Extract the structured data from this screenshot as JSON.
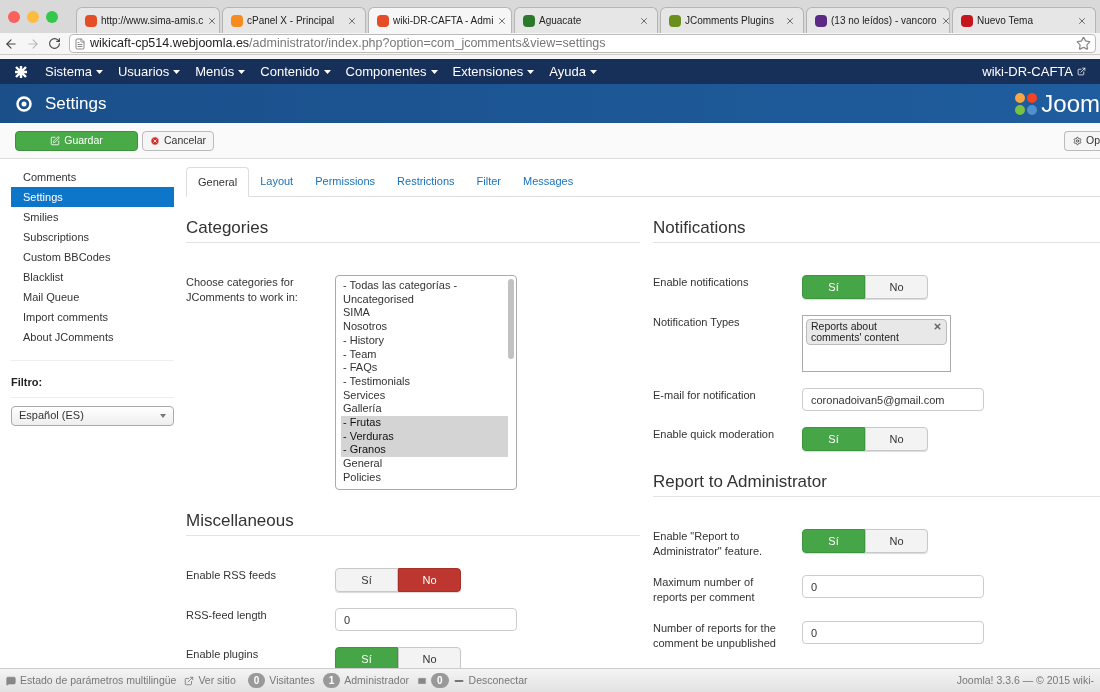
{
  "browser": {
    "tabs": [
      {
        "title": "http://www.sima-amis.c",
        "selected": false
      },
      {
        "title": "cPanel X - Principal",
        "selected": false
      },
      {
        "title": "wiki-DR-CAFTA - Admi",
        "selected": true
      },
      {
        "title": "Aguacate",
        "selected": false
      },
      {
        "title": "JComments Plugins",
        "selected": false
      },
      {
        "title": "(13 no leídos) - vancoro",
        "selected": false
      },
      {
        "title": "Nuevo Tema",
        "selected": false
      }
    ],
    "address": {
      "host": "wikicaft-cp514.webjoomla.es",
      "path": "/administrator/index.php?option=com_jcomments&view=settings"
    }
  },
  "navbar": {
    "menus": [
      "Sistema",
      "Usuarios",
      "Menús",
      "Contenido",
      "Componentes",
      "Extensiones",
      "Ayuda"
    ],
    "site_link": "wiki-DR-CAFTA"
  },
  "header": {
    "title": "Settings",
    "logo": "Joom"
  },
  "toolbar": {
    "buttons": [
      {
        "label": "Guardar",
        "kind": "save"
      },
      {
        "label": "Cancelar",
        "kind": "cancel"
      },
      {
        "label": "Op",
        "kind": "options"
      }
    ]
  },
  "sidebar": {
    "items": [
      {
        "label": "Comments",
        "selected": false
      },
      {
        "label": "Settings",
        "selected": true
      },
      {
        "label": "Smilies",
        "selected": false
      },
      {
        "label": "Subscriptions",
        "selected": false
      },
      {
        "label": "Custom BBCodes",
        "selected": false
      },
      {
        "label": "Blacklist",
        "selected": false
      },
      {
        "label": "Mail Queue",
        "selected": false
      },
      {
        "label": "Import comments",
        "selected": false
      },
      {
        "label": "About JComments",
        "selected": false
      }
    ],
    "filter_label": "Filtro:",
    "filter_value": "Español (ES)"
  },
  "tabs": [
    {
      "label": "General",
      "selected": true
    },
    {
      "label": "Layout",
      "selected": false
    },
    {
      "label": "Permissions",
      "selected": false
    },
    {
      "label": "Restrictions",
      "selected": false
    },
    {
      "label": "Filter",
      "selected": false
    },
    {
      "label": "Messages",
      "selected": false
    }
  ],
  "left_sections": [
    {
      "heading": "Categories",
      "fields": [
        {
          "kind": "listbox",
          "label": "Choose categories for JComments to work in:",
          "options": [
            {
              "label": "- Todas las categorías -",
              "selected": false
            },
            {
              "label": "Uncategorised",
              "selected": false
            },
            {
              "label": "SIMA",
              "selected": false
            },
            {
              "label": "Nosotros",
              "selected": false
            },
            {
              "label": "- History",
              "selected": false
            },
            {
              "label": "- Team",
              "selected": false
            },
            {
              "label": "- FAQs",
              "selected": false
            },
            {
              "label": "- Testimonials",
              "selected": false
            },
            {
              "label": "Services",
              "selected": false
            },
            {
              "label": "Gallería",
              "selected": false
            },
            {
              "label": "- Frutas",
              "selected": true
            },
            {
              "label": "- Verduras",
              "selected": true
            },
            {
              "label": "- Granos",
              "selected": true
            },
            {
              "label": "General",
              "selected": false
            },
            {
              "label": "Policies",
              "selected": false
            }
          ]
        }
      ]
    },
    {
      "heading": "Miscellaneous",
      "fields": [
        {
          "kind": "toggle",
          "label": "Enable RSS feeds",
          "options": [
            {
              "label": "Sí",
              "selected": false
            },
            {
              "label": "No",
              "selected": true
            }
          ]
        },
        {
          "kind": "input",
          "label": "RSS-feed length",
          "value": "0"
        },
        {
          "kind": "toggle",
          "label": "Enable plugins",
          "options": [
            {
              "label": "Sí",
              "selected": true
            },
            {
              "label": "No",
              "selected": false
            }
          ]
        }
      ]
    }
  ],
  "right_sections": [
    {
      "heading": "Notifications",
      "fields": [
        {
          "kind": "toggle",
          "label": "Enable notifications",
          "options": [
            {
              "label": "Sí",
              "selected": true
            },
            {
              "label": "No",
              "selected": false
            }
          ]
        },
        {
          "kind": "tags",
          "label": "Notification Types",
          "tags": [
            "Reports about comments' content"
          ]
        },
        {
          "kind": "input",
          "label": "E-mail for notification",
          "value": "coronadoivan5@gmail.com"
        },
        {
          "kind": "toggle",
          "label": "Enable quick moderation",
          "options": [
            {
              "label": "Sí",
              "selected": true
            },
            {
              "label": "No",
              "selected": false
            }
          ]
        }
      ]
    },
    {
      "heading": "Report to Administrator",
      "fields": [
        {
          "kind": "toggle",
          "label": "Enable \"Report to Administrator\" feature.",
          "options": [
            {
              "label": "Sí",
              "selected": true
            },
            {
              "label": "No",
              "selected": false
            }
          ]
        },
        {
          "kind": "input",
          "label": "Maximum number of reports per comment",
          "value": "0"
        },
        {
          "kind": "input",
          "label": "Number of reports for the comment be unpublished",
          "value": "0"
        }
      ]
    }
  ],
  "status_bar": {
    "multilang": "Estado de parámetros multilingüe",
    "view_site": "Ver sitio",
    "visitors_count": "0",
    "visitors": "Visitantes",
    "admins_count": "1",
    "admins": "Administrador",
    "messages_count": "0",
    "logout": "Desconectar",
    "version": "Joomla! 3.3.6 — © 2015 wiki-"
  }
}
